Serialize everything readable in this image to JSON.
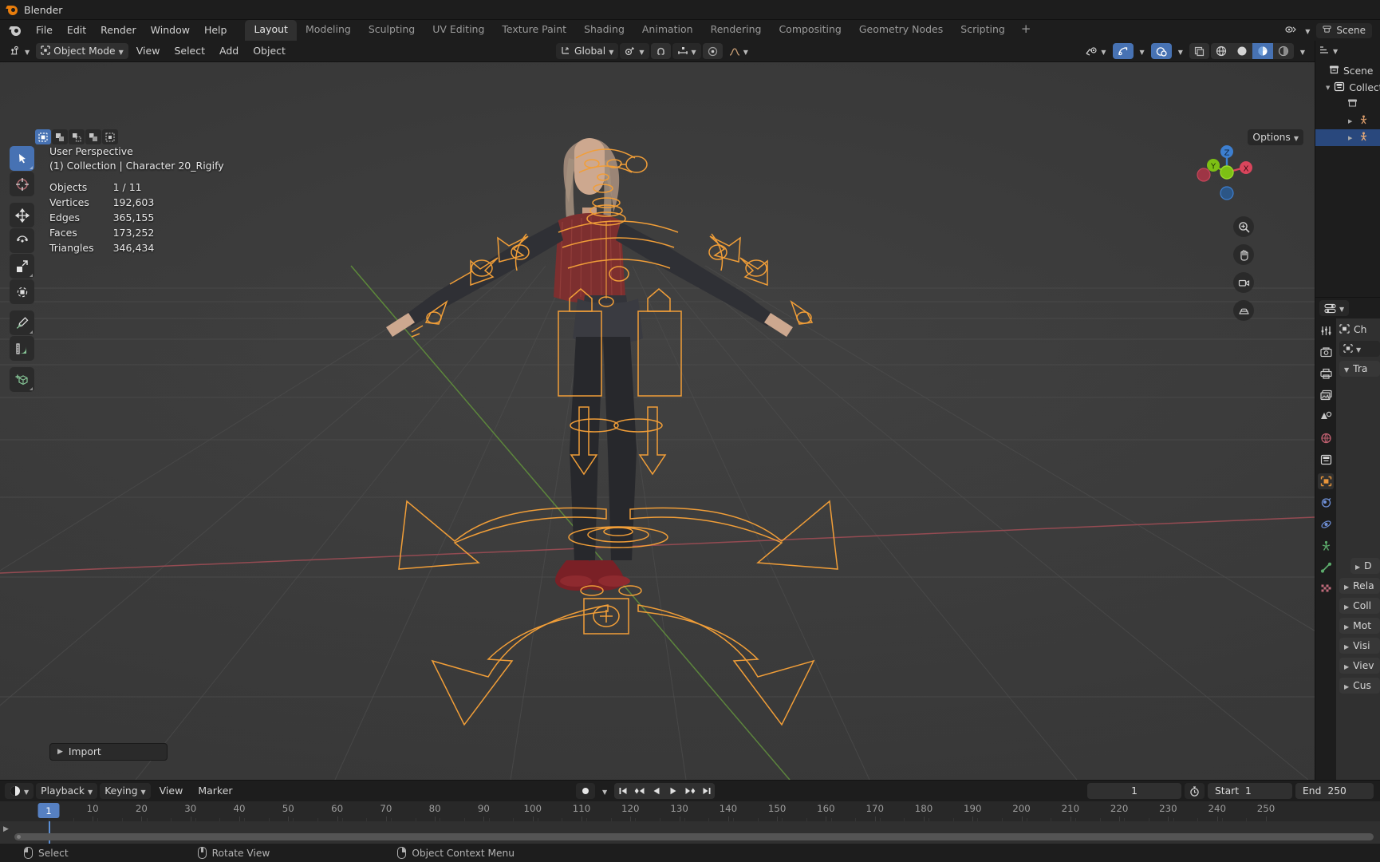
{
  "window": {
    "title": "Blender",
    "app_icon": "blender-logo-icon"
  },
  "topbar": {
    "menus": [
      "File",
      "Edit",
      "Render",
      "Window",
      "Help"
    ],
    "workspaces": [
      {
        "label": "Layout",
        "active": true
      },
      {
        "label": "Modeling",
        "active": false
      },
      {
        "label": "Sculpting",
        "active": false
      },
      {
        "label": "UV Editing",
        "active": false
      },
      {
        "label": "Texture Paint",
        "active": false
      },
      {
        "label": "Shading",
        "active": false
      },
      {
        "label": "Animation",
        "active": false
      },
      {
        "label": "Rendering",
        "active": false
      },
      {
        "label": "Compositing",
        "active": false
      },
      {
        "label": "Geometry Nodes",
        "active": false
      },
      {
        "label": "Scripting",
        "active": false
      }
    ],
    "add_workspace_label": "+",
    "scene_name": "Scene"
  },
  "viewport_header": {
    "editor_type_icon": "editor-type-icon",
    "mode": "Object Mode",
    "menus": [
      "View",
      "Select",
      "Add",
      "Object"
    ],
    "transform_orientation": "Global",
    "snap_icon": "magnet-icon",
    "proportional_icon": "proportional-edit-icon",
    "pivot_icon": "pivot-point-icon",
    "falloff_icon": "falloff-curve-icon",
    "visibility_icon": "visibility-selector-icon",
    "gizmo_icon": "gizmo-icon",
    "overlays_icon": "overlays-icon",
    "xray_icon": "xray-icon",
    "shading_modes": [
      "wireframe",
      "solid",
      "material-preview",
      "rendered"
    ],
    "active_shading": "material-preview"
  },
  "viewport": {
    "options_label": "Options",
    "select_modes": [
      "tweak",
      "box",
      "circle",
      "lasso",
      "extend"
    ],
    "perspective": "User Perspective",
    "collection_info": "(1) Collection | Character 20_Rigify",
    "stats": [
      {
        "label": "Objects",
        "value": "1 / 11"
      },
      {
        "label": "Vertices",
        "value": "192,603"
      },
      {
        "label": "Edges",
        "value": "365,155"
      },
      {
        "label": "Faces",
        "value": "173,252"
      },
      {
        "label": "Triangles",
        "value": "346,434"
      }
    ],
    "operator_panel": "Import",
    "gizmo_axes": [
      {
        "label": "Z",
        "color": "#3d7fd0"
      },
      {
        "label": "Y",
        "color": "#7dc014"
      },
      {
        "label": "X",
        "color": "#d9455c"
      }
    ],
    "nav_buttons": [
      "zoom-icon",
      "pan-hand-icon",
      "camera-icon",
      "ortho-persp-icon"
    ],
    "grid_floor_color": "#4a4a4a",
    "x_axis_color": "#9a4a52",
    "y_axis_color": "#5d8a3a",
    "rig_color": "#f19e38"
  },
  "toolbar": {
    "tools": [
      {
        "name": "tweak-tool",
        "active": true
      },
      {
        "name": "cursor-tool",
        "active": false
      },
      {
        "name": "move-tool",
        "active": false
      },
      {
        "name": "rotate-tool",
        "active": false
      },
      {
        "name": "scale-tool",
        "active": false
      },
      {
        "name": "transform-tool",
        "active": false
      },
      {
        "name": "annotate-tool",
        "active": false
      },
      {
        "name": "measure-tool",
        "active": false
      },
      {
        "name": "add-cube-tool",
        "active": false
      }
    ]
  },
  "outliner": {
    "filter_icon": "filter-icon",
    "search_icon": "search-icon",
    "rows": [
      {
        "label": "Scene",
        "icon": "scene-collection-icon",
        "indent": 0,
        "selected": false,
        "expandable": false
      },
      {
        "label": "Collection",
        "icon": "collection-icon",
        "indent": 1,
        "selected": false,
        "expandable": true
      },
      {
        "label": "",
        "icon": "collection-icon",
        "indent": 2,
        "selected": false,
        "expandable": false
      },
      {
        "label": "",
        "icon": "armature-icon",
        "indent": 3,
        "selected": false,
        "expandable": true
      },
      {
        "label": "",
        "icon": "armature-icon",
        "indent": 3,
        "selected": true,
        "expandable": true
      }
    ]
  },
  "properties": {
    "editor_icon": "properties-editor-icon",
    "breadcrumb_object": "Ch",
    "tabs": [
      {
        "name": "tool-tab",
        "icon": "tool-icon",
        "active": false
      },
      {
        "name": "render-tab",
        "icon": "camera-back-icon",
        "active": false
      },
      {
        "name": "output-tab",
        "icon": "printer-icon",
        "active": false
      },
      {
        "name": "viewlayer-tab",
        "icon": "images-icon",
        "active": false
      },
      {
        "name": "scene-tab",
        "icon": "cone-droplet-icon",
        "active": false
      },
      {
        "name": "world-tab",
        "icon": "world-icon",
        "active": false
      },
      {
        "name": "collection-tab",
        "icon": "collection-icon",
        "active": false
      },
      {
        "name": "object-tab",
        "icon": "object-icon",
        "active": true
      },
      {
        "name": "modifiers-tab",
        "icon": "wrench-icon",
        "active": false
      },
      {
        "name": "physics-tab",
        "icon": "physics-icon",
        "active": false
      },
      {
        "name": "constraints-tab",
        "icon": "constraint-icon",
        "active": false
      },
      {
        "name": "data-tab",
        "icon": "bone-data-icon",
        "active": false
      },
      {
        "name": "material-tab",
        "icon": "checker-icon",
        "active": false
      }
    ],
    "panels": [
      {
        "label": "Tra",
        "expanded": true,
        "sub": false
      },
      {
        "label": "D",
        "expanded": false,
        "sub": true
      },
      {
        "label": "Rela",
        "expanded": false,
        "sub": false
      },
      {
        "label": "Coll",
        "expanded": false,
        "sub": false
      },
      {
        "label": "Mot",
        "expanded": false,
        "sub": false
      },
      {
        "label": "Visi",
        "expanded": false,
        "sub": false
      },
      {
        "label": "Viev",
        "expanded": false,
        "sub": false
      },
      {
        "label": "Cus",
        "expanded": false,
        "sub": false
      }
    ]
  },
  "timeline": {
    "editor_icon": "timeline-editor-icon",
    "menus": [
      "Playback",
      "Keying",
      "View",
      "Marker"
    ],
    "record_icon": "auto-keying-icon",
    "transport": [
      "jump-start-icon",
      "prev-keyframe-icon",
      "play-reverse-icon",
      "play-icon",
      "next-keyframe-icon",
      "jump-end-icon"
    ],
    "current_frame": "1",
    "use_preview_icon": "stopwatch-icon",
    "start_label": "Start",
    "start_value": "1",
    "end_label": "End",
    "end_value": "250",
    "ticks": [
      "1",
      "10",
      "20",
      "30",
      "40",
      "50",
      "60",
      "70",
      "80",
      "90",
      "100",
      "110",
      "120",
      "130",
      "140",
      "150",
      "160",
      "170",
      "180",
      "190",
      "200",
      "210",
      "220",
      "230",
      "240",
      "250"
    ],
    "playhead_frame": "1"
  },
  "statusbar": {
    "items": [
      {
        "icon": "mouse-left-icon",
        "label": "Select"
      },
      {
        "icon": "mouse-middle-icon",
        "label": "Rotate View"
      },
      {
        "icon": "mouse-right-icon",
        "label": "Object Context Menu"
      }
    ]
  }
}
